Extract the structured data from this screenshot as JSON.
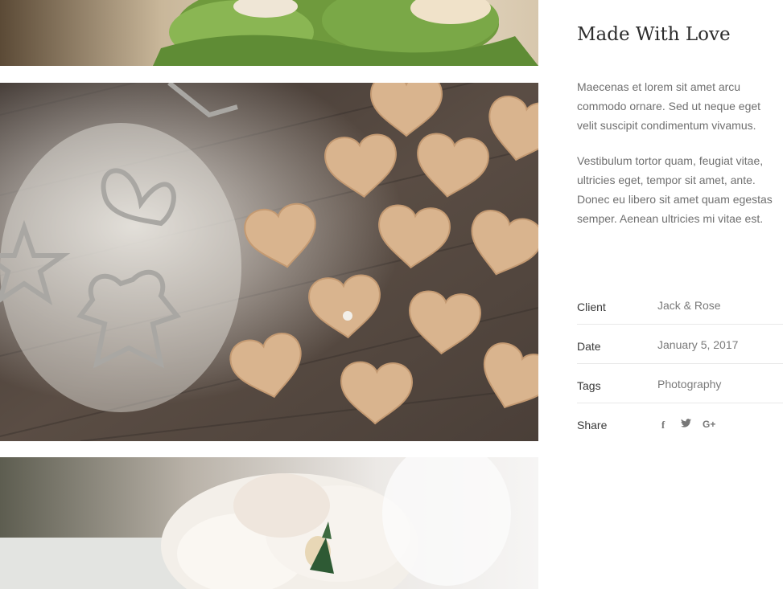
{
  "project": {
    "title": "Made With Love",
    "paragraphs": [
      "Maecenas et lorem sit amet arcu commodo ornare. Sed ut neque eget velit suscipit condimentum vivamus.",
      "Vestibulum tortor quam, feugiat vitae, ultricies eget, tempor sit amet, ante. Donec eu libero sit amet quam egestas semper. Aenean ultricies mi vitae est."
    ],
    "meta": [
      {
        "label": "Client",
        "value": "Jack & Rose"
      },
      {
        "label": "Date",
        "value": "January 5, 2017"
      },
      {
        "label": "Tags",
        "value": "Photography"
      }
    ],
    "share": {
      "label": "Share",
      "icons": [
        {
          "name": "facebook-icon",
          "glyph": "f"
        },
        {
          "name": "twitter-icon",
          "glyph": "🐦"
        },
        {
          "name": "google-plus-icon",
          "glyph": "G+"
        }
      ]
    }
  },
  "gallery": {
    "photos": [
      {
        "subject": "flowers-greenery"
      },
      {
        "subject": "heart-shaped-cookies-on-floured-wooden-table"
      },
      {
        "subject": "white-peony-bridal-bouquet"
      }
    ]
  }
}
